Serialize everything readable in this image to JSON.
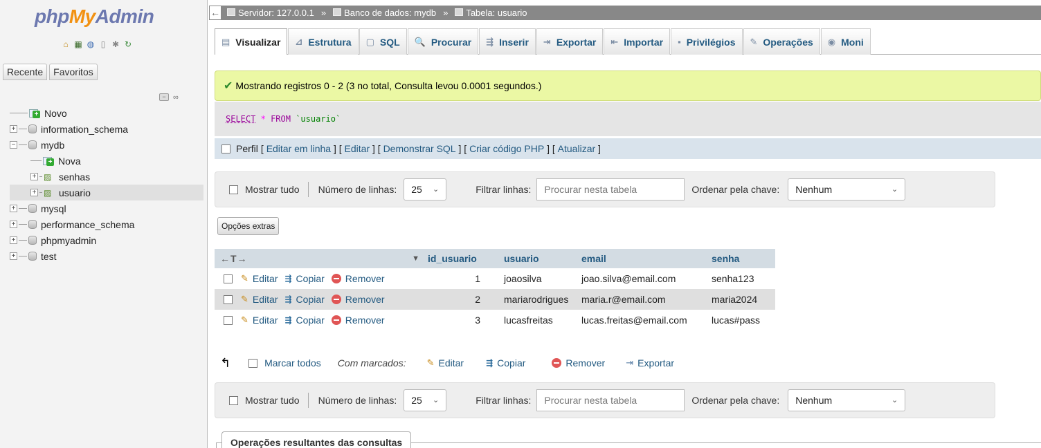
{
  "app": {
    "logo_php": "php",
    "logo_my": "My",
    "logo_admin": "Admin"
  },
  "nav": {
    "icons": [
      "home-icon",
      "database-icon",
      "help-icon",
      "docs-icon",
      "settings-icon",
      "reload-icon"
    ],
    "tabs": [
      "Recente",
      "Favoritos"
    ],
    "tree": [
      {
        "label": "Novo",
        "type": "new",
        "indent": 0
      },
      {
        "label": "information_schema",
        "type": "db",
        "indent": 0
      },
      {
        "label": "mydb",
        "type": "db-open",
        "indent": 0
      },
      {
        "label": "Nova",
        "type": "new",
        "indent": 1
      },
      {
        "label": "senhas",
        "type": "table",
        "indent": 1
      },
      {
        "label": "usuario",
        "type": "table",
        "indent": 1
      },
      {
        "label": "mysql",
        "type": "db",
        "indent": 0
      },
      {
        "label": "performance_schema",
        "type": "db",
        "indent": 0
      },
      {
        "label": "phpmyadmin",
        "type": "db",
        "indent": 0
      },
      {
        "label": "test",
        "type": "db",
        "indent": 0
      }
    ]
  },
  "breadcrumb": {
    "server": "Servidor: 127.0.0.1",
    "database": "Banco de dados: mydb",
    "table": "Tabela: usuario",
    "sep": "»"
  },
  "tabs": [
    {
      "label": "Visualizar",
      "icon": "table-icon",
      "glyph": "▤",
      "active": true
    },
    {
      "label": "Estrutura",
      "icon": "structure-icon",
      "glyph": "⊿",
      "active": false
    },
    {
      "label": "SQL",
      "icon": "sql-icon",
      "glyph": "▢",
      "active": false
    },
    {
      "label": "Procurar",
      "icon": "search-icon",
      "glyph": "🔍",
      "active": false
    },
    {
      "label": "Inserir",
      "icon": "insert-icon",
      "glyph": "⇶",
      "active": false
    },
    {
      "label": "Exportar",
      "icon": "export-icon",
      "glyph": "⇥",
      "active": false
    },
    {
      "label": "Importar",
      "icon": "import-icon",
      "glyph": "⇤",
      "active": false
    },
    {
      "label": "Privilégios",
      "icon": "privileges-icon",
      "glyph": "▪",
      "active": false
    },
    {
      "label": "Operações",
      "icon": "wrench-icon",
      "glyph": "✎",
      "active": false
    },
    {
      "label": "Moni",
      "icon": "monitor-icon",
      "glyph": "◉",
      "active": false
    }
  ],
  "message": "Mostrando registros 0 - 2 (3 no total, Consulta levou 0.0001 segundos.)",
  "sql": {
    "select": "SELECT",
    "star": "*",
    "from": "FROM",
    "table": "`usuario`"
  },
  "sql_links": {
    "profile": "Perfil",
    "edit_inline": "Editar em linha",
    "edit": "Editar",
    "explain": "Demonstrar SQL",
    "create_php": "Criar código PHP",
    "refresh": "Atualizar"
  },
  "navbar": {
    "show_all": "Mostrar tudo",
    "rows_label": "Número de linhas:",
    "rows_value": "25",
    "filter_label": "Filtrar linhas:",
    "filter_placeholder": "Procurar nesta tabela",
    "sort_label": "Ordenar pela chave:",
    "sort_value": "Nenhum"
  },
  "extra_options": "Opções extras",
  "table": {
    "arrows": "←T→",
    "columns": [
      "id_usuario",
      "usuario",
      "email",
      "senha"
    ],
    "actions": {
      "edit": "Editar",
      "copy": "Copiar",
      "remove": "Remover"
    },
    "rows": [
      {
        "id_usuario": "1",
        "usuario": "joaosilva",
        "email": "joao.silva@email.com",
        "senha": "senha123"
      },
      {
        "id_usuario": "2",
        "usuario": "mariarodrigues",
        "email": "maria.r@email.com",
        "senha": "maria2024"
      },
      {
        "id_usuario": "3",
        "usuario": "lucasfreitas",
        "email": "lucas.freitas@email.com",
        "senha": "lucas#pass"
      }
    ]
  },
  "bulk": {
    "check_all": "Marcar todos",
    "with_selected": "Com marcados:",
    "edit": "Editar",
    "copy": "Copiar",
    "remove": "Remover",
    "export": "Exportar"
  },
  "query_ops": "Operações resultantes das consultas"
}
